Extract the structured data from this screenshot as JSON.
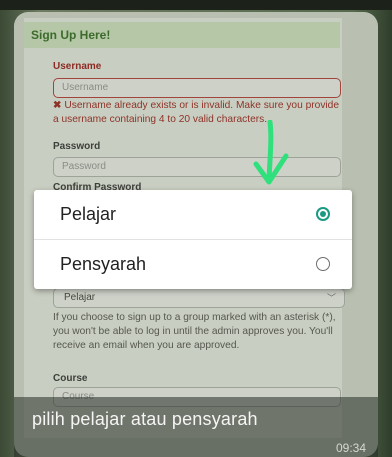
{
  "form": {
    "header": "Sign Up Here!",
    "username_label": "Username",
    "username_placeholder": "Username",
    "username_error_icon": "✖",
    "username_error": "Username already exists or is invalid. Make sure you provide a username containing 4 to 20 valid characters.",
    "password_label": "Password",
    "password_placeholder": "Password",
    "confirm_password_label": "Confirm Password",
    "group_selected": "Pelajar",
    "group_help": "If you choose to sign up to a group marked with an asterisk (*), you won't be able to log in until the admin approves you. You'll receive an email when you are approved.",
    "course_label": "Course",
    "course_placeholder": "Course"
  },
  "popup": {
    "options": [
      {
        "label": "Pelajar",
        "selected": true
      },
      {
        "label": "Pensyarah",
        "selected": false
      }
    ]
  },
  "overlay": {
    "caption": "pilih pelajar atau pensyarah",
    "timestamp": "09:34",
    "arrow_color": "#2fe07c"
  }
}
